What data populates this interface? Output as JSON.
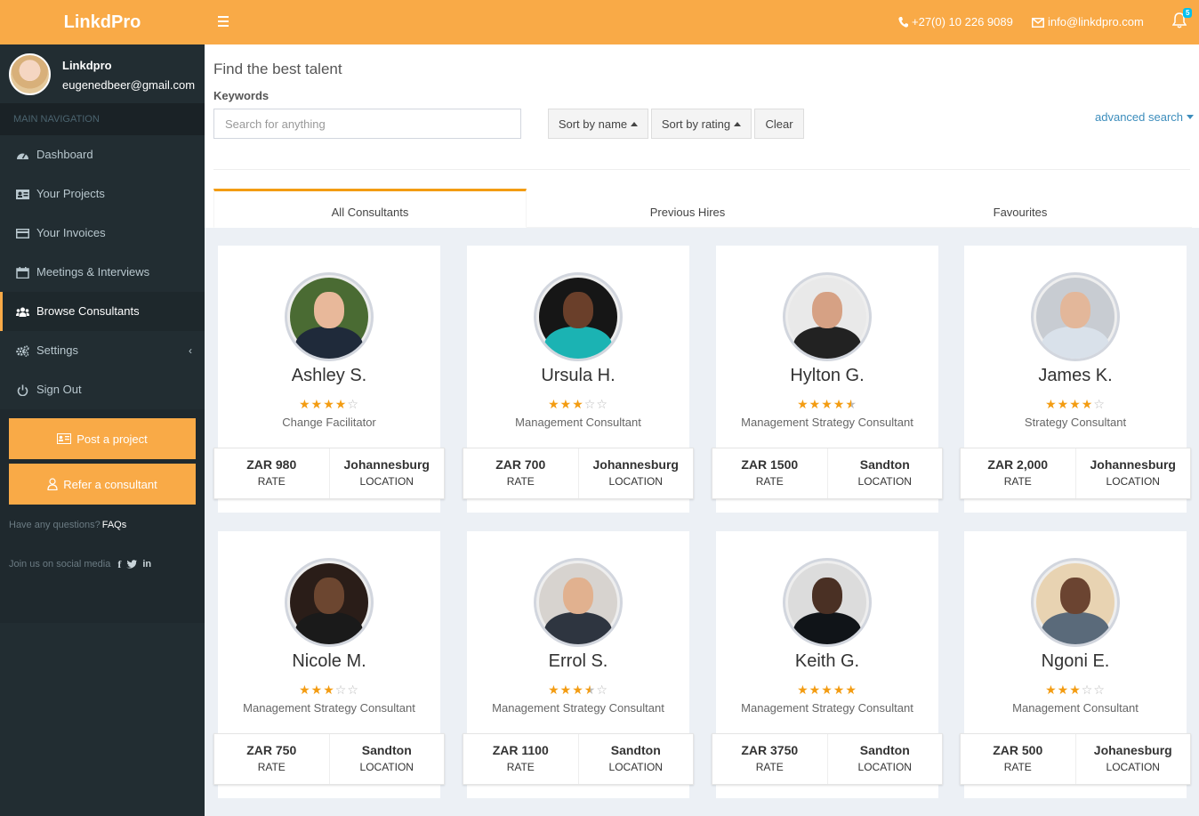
{
  "header": {
    "logo": "LinkdPro",
    "phone": "+27(0) 10 226 9089",
    "email": "info@linkdpro.com",
    "notifications_count": "5"
  },
  "sidebar": {
    "user_name": "Linkdpro",
    "user_email": "eugenedbeer@gmail.com",
    "nav_header": "MAIN NAVIGATION",
    "items": [
      {
        "label": "Dashboard",
        "icon": "dashboard-icon"
      },
      {
        "label": "Your Projects",
        "icon": "id-card-icon"
      },
      {
        "label": "Your Invoices",
        "icon": "credit-card-icon"
      },
      {
        "label": "Meetings & Interviews",
        "icon": "calendar-icon"
      },
      {
        "label": "Browse Consultants",
        "icon": "users-icon",
        "active": true
      },
      {
        "label": "Settings",
        "icon": "gears-icon"
      },
      {
        "label": "Sign Out",
        "icon": "power-icon"
      }
    ],
    "post_project": "Post a project",
    "refer_consultant": "Refer a consultant",
    "questions_text": "Have any questions?",
    "faqs_link": "FAQs",
    "social_text": "Join us on social media"
  },
  "main": {
    "title": "Find the best talent",
    "keywords_label": "Keywords",
    "search_placeholder": "Search for anything",
    "sort_name": "Sort by name",
    "sort_rating": "Sort by rating",
    "clear": "Clear",
    "advanced_search": "advanced search",
    "tabs": [
      "All Consultants",
      "Previous Hires",
      "Favourites"
    ]
  },
  "rate_label": "RATE",
  "location_label": "LOCATION",
  "consultants": [
    {
      "name": "Ashley S.",
      "rating": 4,
      "role": "Change Facilitator",
      "rate": "ZAR 980",
      "location": "Johannesburg"
    },
    {
      "name": "Ursula H.",
      "rating": 3,
      "role": "Management Consultant",
      "rate": "ZAR 700",
      "location": "Johannesburg"
    },
    {
      "name": "Hylton G.",
      "rating": 4.5,
      "role": "Management Strategy Consultant",
      "rate": "ZAR 1500",
      "location": "Sandton"
    },
    {
      "name": "James K.",
      "rating": 4,
      "role": "Strategy Consultant",
      "rate": "ZAR 2,000",
      "location": "Johannesburg"
    },
    {
      "name": "Nicole M.",
      "rating": 3,
      "role": "Management Strategy Consultant",
      "rate": "ZAR 750",
      "location": "Sandton"
    },
    {
      "name": "Errol S.",
      "rating": 3.5,
      "role": "Management Strategy Consultant",
      "rate": "ZAR 1100",
      "location": "Sandton"
    },
    {
      "name": "Keith G.",
      "rating": 5,
      "role": "Management Strategy Consultant",
      "rate": "ZAR 3750",
      "location": "Sandton"
    },
    {
      "name": "Ngoni E.",
      "rating": 3,
      "role": "Management Consultant",
      "rate": "ZAR 500",
      "location": "Johanesburg"
    }
  ],
  "colors": {
    "accent": "#f9aa47",
    "sidebar": "#222d32",
    "link": "#3c8dbc",
    "star": "#f39c12"
  }
}
